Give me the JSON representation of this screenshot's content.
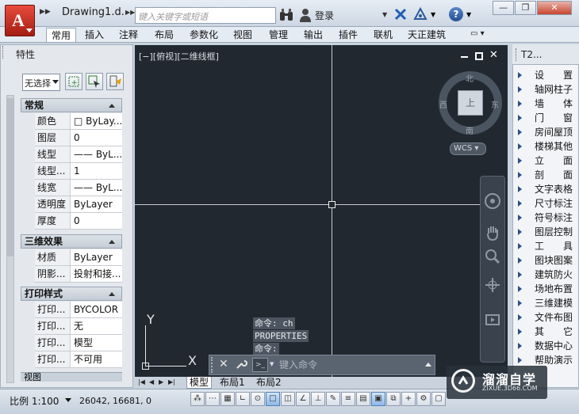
{
  "titlebar": {
    "document_title": "Drawing1.d...",
    "search_placeholder": "键入关键字或短语",
    "login_label": "登录",
    "window_minimize": "—",
    "window_restore": "❐",
    "window_close": "✕"
  },
  "ribbon": {
    "tabs": [
      "常用",
      "插入",
      "注释",
      "布局",
      "参数化",
      "视图",
      "管理",
      "输出",
      "插件",
      "联机",
      "天正建筑"
    ],
    "active_tab": "常用"
  },
  "properties": {
    "title": "特性",
    "selection": "无选择",
    "sections": [
      {
        "name": "常规",
        "rows": [
          {
            "key": "颜色",
            "value": "□ ByLay..."
          },
          {
            "key": "图层",
            "value": "0"
          },
          {
            "key": "线型",
            "value": "—— ByL..."
          },
          {
            "key": "线型...",
            "value": "1"
          },
          {
            "key": "线宽",
            "value": "—— ByL..."
          },
          {
            "key": "透明度",
            "value": "ByLayer"
          },
          {
            "key": "厚度",
            "value": "0"
          }
        ]
      },
      {
        "name": "三维效果",
        "rows": [
          {
            "key": "材质",
            "value": "ByLayer"
          },
          {
            "key": "阴影...",
            "value": "投射和接..."
          }
        ]
      },
      {
        "name": "打印样式",
        "rows": [
          {
            "key": "打印...",
            "value": "BYCOLOR"
          },
          {
            "key": "打印...",
            "value": "无"
          },
          {
            "key": "打印...",
            "value": "模型"
          },
          {
            "key": "打印...",
            "value": "不可用"
          }
        ]
      }
    ],
    "next_section": "视图"
  },
  "viewport": {
    "label": "[−][俯视][二维线框]",
    "viewcube": {
      "top": "上",
      "north": "北",
      "south": "南",
      "east": "东",
      "west": "西",
      "wcs": "WCS"
    },
    "ucs": {
      "x": "X",
      "y": "Y"
    }
  },
  "command": {
    "history": [
      "命令: ch",
      "PROPERTIES",
      "命令:"
    ],
    "placeholder": "键入命令"
  },
  "layout_tabs": [
    "模型",
    "布局1",
    "布局2"
  ],
  "tool_palette": {
    "title": "T2...",
    "items": [
      "设　　置",
      "轴网柱子",
      "墙　　体",
      "门　　窗",
      "房间屋顶",
      "楼梯其他",
      "立　　面",
      "剖　　面",
      "文字表格",
      "尺寸标注",
      "符号标注",
      "图层控制",
      "工　　具",
      "图块图案",
      "建筑防火",
      "场地布置",
      "三维建模",
      "文件布图",
      "其　　它",
      "数据中心",
      "帮助演示"
    ]
  },
  "statusbar": {
    "scale": "比例 1:100",
    "coordinates": "26042, 16681, 0"
  },
  "watermark": {
    "title": "溜溜自学",
    "subtitle": "ZIXUE.3D66.COM"
  },
  "colors": {
    "canvas": "#212830",
    "accent_red": "#c4271a",
    "palette_arrow": "#2b4f84"
  }
}
